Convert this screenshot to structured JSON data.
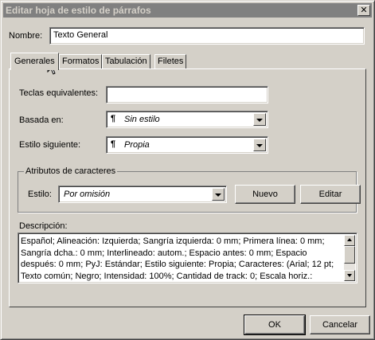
{
  "window": {
    "title": "Editar hoja de estilo de párrafos",
    "close_glyph": "✕"
  },
  "name_field": {
    "label": "Nombre:",
    "value": "Texto General"
  },
  "tabs": [
    {
      "label": "Generales",
      "active": true
    },
    {
      "label": "Formatos",
      "active": false
    },
    {
      "label": "Tabulación",
      "active": false
    },
    {
      "label": "Filetes",
      "active": false
    }
  ],
  "general": {
    "keys_label": "Teclas equivalentes:",
    "keys_value": "",
    "based_on_label": "Basada en:",
    "based_on_value": "Sin estilo",
    "next_style_label": "Estilo siguiente:",
    "next_style_value": "Propia",
    "paragraph_glyph": "¶"
  },
  "char_attrs": {
    "group_label": "Atributos de caracteres",
    "style_label": "Estilo:",
    "style_value": "Por omisión",
    "new_label": "Nuevo",
    "edit_label": "Editar"
  },
  "description": {
    "label": "Descripción:",
    "lines": [
      "Español;  Alineación: Izquierda;  Sangría izquierda: 0 mm;  Primera línea: 0 mm;",
      "Sangría dcha.: 0 mm;  Interlineado: autom.;  Espacio antes: 0 mm;  Espacio",
      "después: 0 mm;  PyJ: Estándar;  Estilo siguiente: Propia;  Caracteres: (Arial;  12 pt;",
      "Texto común;  Negro;  Intensidad: 100%;  Cantidad de track: 0;  Escala horiz.:"
    ]
  },
  "footer": {
    "ok_label": "OK",
    "cancel_label": "Cancelar"
  },
  "icons": {
    "cursor": "mouse-pointer-icon",
    "dropdown": "chevron-down-icon",
    "paragraph": "pilcrow-icon"
  }
}
